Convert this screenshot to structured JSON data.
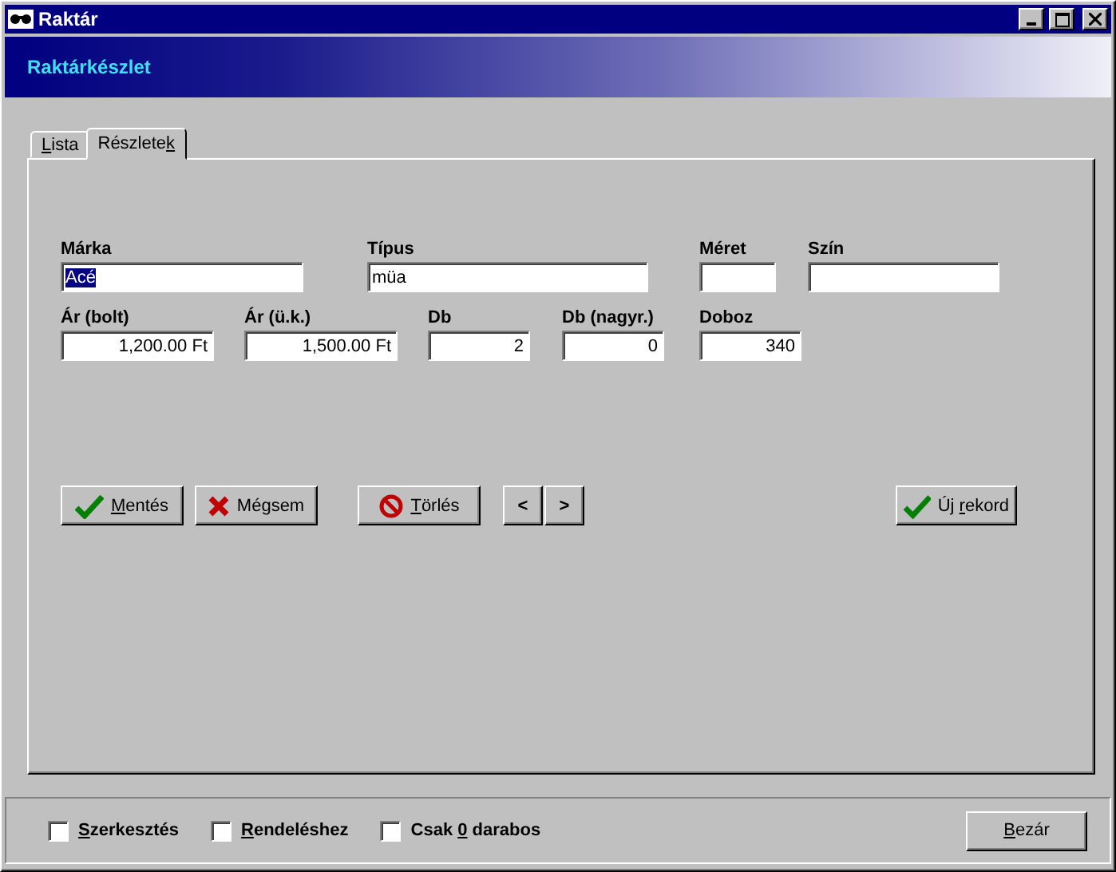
{
  "window": {
    "title": "Raktár"
  },
  "header": {
    "title": "Raktárkészlet"
  },
  "tabs": [
    {
      "label": {
        "key": "L",
        "after": "ista"
      },
      "selected": false
    },
    {
      "label": {
        "before": "Részlete",
        "key": "k"
      },
      "selected": true
    }
  ],
  "fields": [
    [
      {
        "label": "Márka",
        "value": "Acé",
        "text_selected": true
      },
      {
        "label": "Típus",
        "value": "müa",
        "text_selected": false
      },
      {
        "label": "Méret"
      },
      {
        "label": "Szín"
      }
    ],
    [
      {
        "label": "Ár (bolt)",
        "value": "1,200.00 Ft",
        "text_selected": false
      },
      {
        "label": "Ár (ü.k.)",
        "value": "1,500.00 Ft",
        "text_selected": false
      },
      {
        "label": "Db",
        "value": "2",
        "text_selected": false
      },
      {
        "label": "Db (nagyr.)",
        "value": "0",
        "text_selected": false
      },
      {
        "label": "Doboz",
        "value": "340",
        "text_selected": false
      }
    ]
  ],
  "buttons": [
    {
      "kind": "check",
      "label": {
        "key": "M",
        "after": "entés"
      }
    },
    {
      "kind": "cross",
      "label": {
        "before": "Mé",
        "key": "g",
        "after": "sem"
      }
    },
    {
      "kind": "forbid",
      "label": {
        "key": "T",
        "after": "örlés"
      }
    },
    {
      "kind": "nav",
      "label": {
        "before": "<"
      }
    },
    {
      "kind": "nav",
      "label": {
        "before": ">"
      }
    },
    {
      "kind": "check",
      "label": {
        "before": "Új ",
        "key": "r",
        "after": "ekord"
      }
    }
  ],
  "options": [
    {
      "label": {
        "key": "S",
        "after": "zerkesztés"
      },
      "checked": false
    },
    {
      "label": {
        "key": "R",
        "after": "endeléshez"
      },
      "checked": false
    },
    {
      "label": {
        "before": "Csak ",
        "key": "0",
        "after": " darabos"
      },
      "checked": false
    }
  ],
  "close_button": {
    "label": {
      "key": "B",
      "after": "ezár"
    }
  }
}
